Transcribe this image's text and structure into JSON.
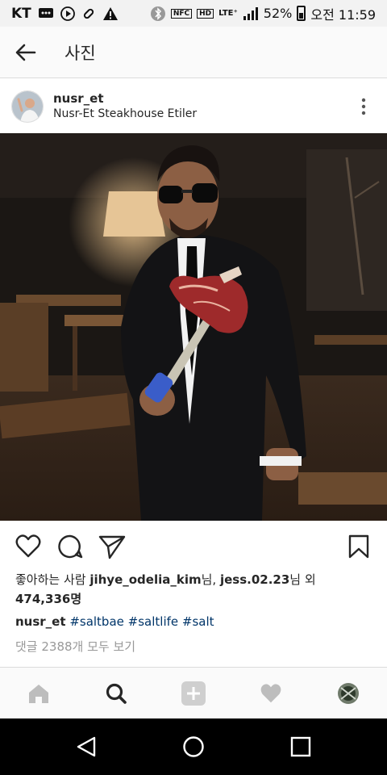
{
  "status_bar": {
    "carrier": "KT",
    "icons": [
      "message-icon",
      "play-icon",
      "link-icon",
      "warning-icon",
      "bluetooth-icon",
      "nfc-icon",
      "hd-icon",
      "lte-icon",
      "signal-icon"
    ],
    "nfc_label": "NFC",
    "hd_label": "HD",
    "lte_label": "LTE⁺",
    "battery": "52%",
    "time": "오전 11:59"
  },
  "app_bar": {
    "title": "사진",
    "back_icon": "arrow-left-icon"
  },
  "post": {
    "username": "nusr_et",
    "location": "Nusr-Et Steakhouse Etiler",
    "likes_prefix": "좋아하는 사람 ",
    "likes_user1": "jihye_odelia_kim",
    "likes_mid": "님, ",
    "likes_user2": "jess.02.23",
    "likes_suffix": "님 외",
    "likes_count": "474,336명",
    "caption_user": "nusr_et",
    "hashtags": [
      "#saltbae",
      "#saltlife",
      "#salt"
    ],
    "comments_link": "댓글 2388개 모두 보기"
  },
  "actions": [
    "heart-icon",
    "comment-icon",
    "share-icon",
    "bookmark-icon"
  ],
  "tab_bar": [
    "home-icon",
    "search-icon",
    "add-icon",
    "activity-heart-icon",
    "profile-avatar"
  ],
  "nav_bar": [
    "back-triangle-icon",
    "home-circle-icon",
    "recents-square-icon"
  ],
  "colors": {
    "link": "#003569",
    "muted": "#999999",
    "text": "#262626",
    "divider": "#dbdbdb"
  }
}
